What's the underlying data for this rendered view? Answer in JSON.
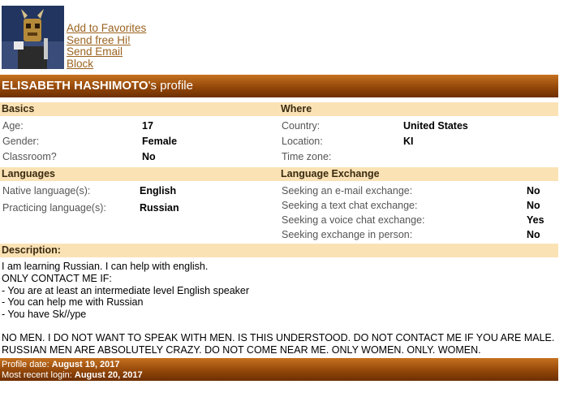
{
  "actions": {
    "add_favorites": "Add to Favorites",
    "send_hi": "Send free Hi!",
    "send_email": "Send Email",
    "block": "Block"
  },
  "profile": {
    "name": "ELISABETH HASHIMOTO",
    "title_suffix": "'s profile"
  },
  "basics": {
    "heading": "Basics",
    "rows": [
      {
        "label": "Age:",
        "value": "17"
      },
      {
        "label": "Gender:",
        "value": "Female"
      },
      {
        "label": "Classroom?",
        "value": "No"
      }
    ]
  },
  "where": {
    "heading": "Where",
    "rows": [
      {
        "label": "Country:",
        "value": "United States"
      },
      {
        "label": "Location:",
        "value": "KI"
      },
      {
        "label": "Time zone:",
        "value": ""
      }
    ]
  },
  "languages": {
    "heading": "Languages",
    "rows": [
      {
        "label": "Native language(s):",
        "value": "English"
      },
      {
        "label": "Practicing language(s):",
        "value": "Russian"
      }
    ]
  },
  "exchange": {
    "heading": "Language Exchange",
    "rows": [
      {
        "label": "Seeking an e-mail exchange:",
        "value": "No"
      },
      {
        "label": "Seeking a text chat exchange:",
        "value": "No"
      },
      {
        "label": "Seeking a voice chat exchange:",
        "value": "Yes"
      },
      {
        "label": "Seeking exchange in person:",
        "value": "No"
      }
    ]
  },
  "description": {
    "heading": "Description:",
    "lines": [
      "I am learning Russian. I can help with english.",
      "ONLY CONTACT ME IF:",
      "- You are at least an intermediate level English speaker",
      "- You can help me with Russian",
      "- You have Sk//ype"
    ],
    "warning": "NO MEN. I DO NOT WANT TO SPEAK WITH MEN. IS THIS UNDERSTOOD. DO NOT CONTACT ME IF YOU ARE MALE. RUSSIAN MEN ARE ABSOLUTELY CRAZY. DO NOT COME NEAR ME. ONLY WOMEN. ONLY. WOMEN."
  },
  "footer": {
    "profile_date_label": "Profile date:",
    "profile_date": "August 19, 2017",
    "login_label": "Most recent login:",
    "login_date": "August 20, 2017"
  },
  "colors": {
    "header_bar": "#8f4408",
    "section_bg": "#fbe2b5",
    "link": "#9b6320"
  }
}
